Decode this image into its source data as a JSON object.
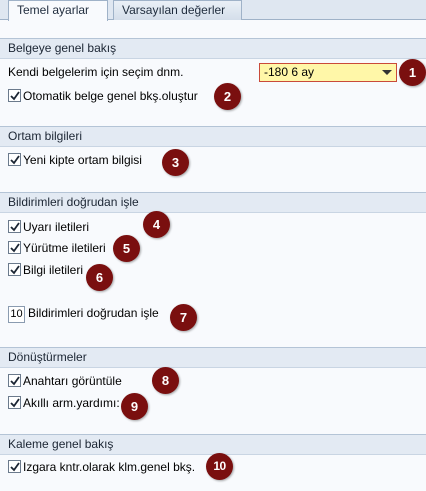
{
  "tabs": [
    "Temel ayarlar",
    "Varsayılan değerler"
  ],
  "group_belgeye": {
    "title": "Belgeye genel bakış",
    "selection_label": "Kendi belgelerim için seçim dnm.",
    "selection_value": "-180 6 ay",
    "auto_label": "Otomatik belge genel bkş.oluştur"
  },
  "group_ortam": {
    "title": "Ortam bilgileri",
    "new_mode_label": "Yeni kipte ortam bilgisi"
  },
  "group_bildirim": {
    "title": "Bildirimleri doğrudan işle",
    "warning_label": "Uyarı iletileri",
    "exec_label": "Yürütme iletileri",
    "info_label": "Bilgi iletileri",
    "count_value": "10",
    "count_label": "Bildirimleri doğrudan işle"
  },
  "group_donusturme": {
    "title": "Dönüştürmeler",
    "key_label": "Anahtarı görüntüle",
    "smart_label": "Akıllı arm.yardımı:"
  },
  "group_kaleme": {
    "title": "Kaleme genel bakış",
    "grid_label": "Izgara kntr.olarak klm.genel bkş."
  },
  "callouts": [
    "1",
    "2",
    "3",
    "4",
    "5",
    "6",
    "7",
    "8",
    "9",
    "10"
  ],
  "colors": {
    "callout": "#7a0f0f",
    "header_bg": "#e3eaf3",
    "select_bg": "#fff7a8"
  }
}
